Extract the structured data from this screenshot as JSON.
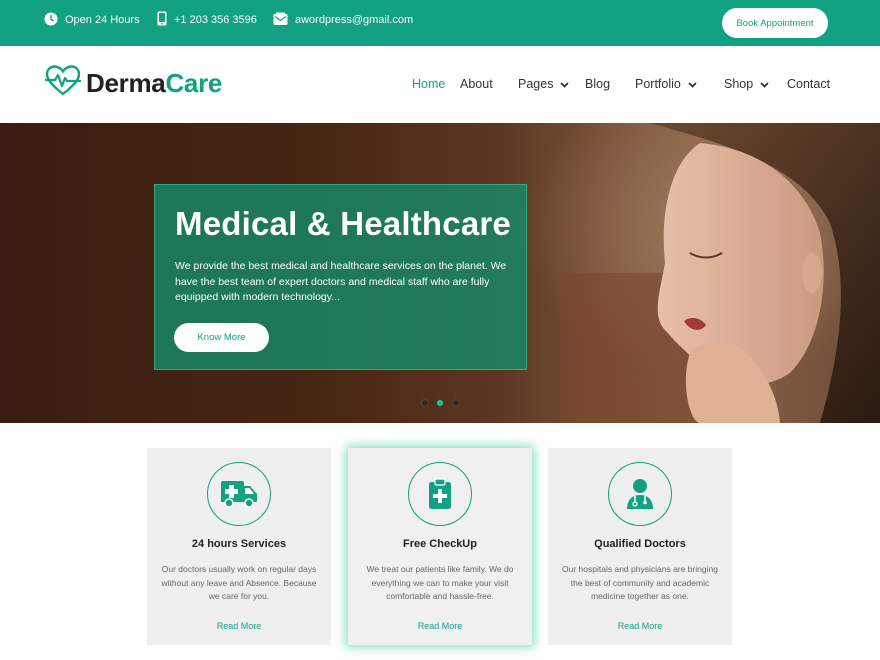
{
  "topbar": {
    "hours": "Open 24 Hours",
    "phone": "+1 203 356 3596",
    "email": "awordpress@gmail.com",
    "appointment_label": "Book Appointment",
    "icons": [
      "clock-icon",
      "phone-icon",
      "mail-icon"
    ]
  },
  "brand": {
    "name_part1": "Derma",
    "name_part2": "Care",
    "logo_icon": "heart-pulse-icon"
  },
  "nav": {
    "items": [
      {
        "label": "Home",
        "active": true
      },
      {
        "label": "About"
      },
      {
        "label": "Pages",
        "dropdown": true
      },
      {
        "label": "Blog"
      },
      {
        "label": "Portfolio",
        "dropdown": true
      },
      {
        "label": "Shop",
        "dropdown": true
      },
      {
        "label": "Contact"
      }
    ]
  },
  "hero": {
    "title": "Medical & Healthcare",
    "description": "We provide the best medical and healthcare services on the planet. We have the best team of expert doctors and medical staff who are fully equipped with modern technology...",
    "button_label": "Know More",
    "slide_count": 3,
    "active_slide": 2
  },
  "cards": [
    {
      "icon": "ambulance-icon",
      "title": "24 hours Services",
      "description": "Our doctors usually work on regular days without any leave and Absence. Because we care for you.",
      "link": "Read More"
    },
    {
      "icon": "clipboard-medical-icon",
      "title": "Free CheckUp",
      "description": "We treat our patients like family. We do everything we can to make your visit comfortable and hassle-free.",
      "link": "Read More",
      "featured": true
    },
    {
      "icon": "doctor-icon",
      "title": "Qualified Doctors",
      "description": "Our hospitals and physicians are bringing the best of community and academic medicine together as one.",
      "link": "Read More"
    }
  ],
  "colors": {
    "brand": "#12a281",
    "hero_bg": "#462513",
    "card_bg": "#efefef"
  }
}
